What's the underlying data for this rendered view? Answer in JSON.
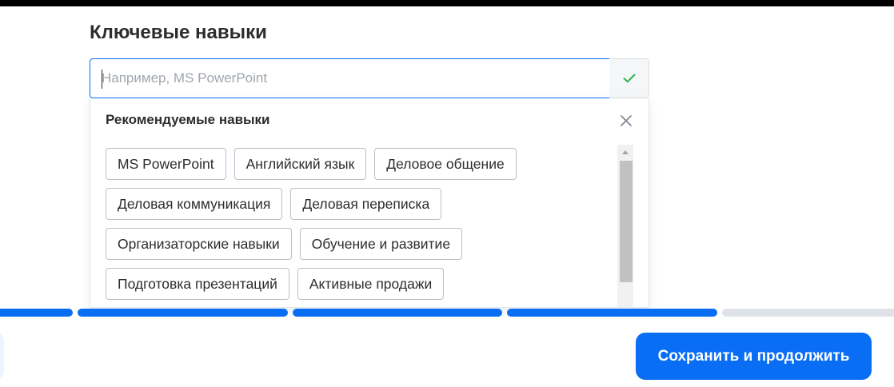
{
  "section": {
    "title": "Ключевые навыки"
  },
  "skill_input": {
    "placeholder": "Например, MS PowerPoint",
    "value": ""
  },
  "confirm_button": {
    "icon": "check-icon",
    "color": "#2bb24c"
  },
  "suggestions": {
    "title": "Рекомендуемые навыки",
    "close_icon": "close-icon",
    "items": [
      "MS PowerPoint",
      "Английский язык",
      "Деловое общение",
      "Деловая коммуникация",
      "Деловая переписка",
      "Организаторские навыки",
      "Обучение и развитие",
      "Подготовка презентаций",
      "Активные продажи"
    ]
  },
  "progress": {
    "total_steps": 5,
    "completed_steps": 4,
    "active_color": "#0a6ef5",
    "inactive_color": "#dfe3e8"
  },
  "footer": {
    "save_label": "Сохранить и продолжить",
    "accent": "#0a6ef5"
  }
}
